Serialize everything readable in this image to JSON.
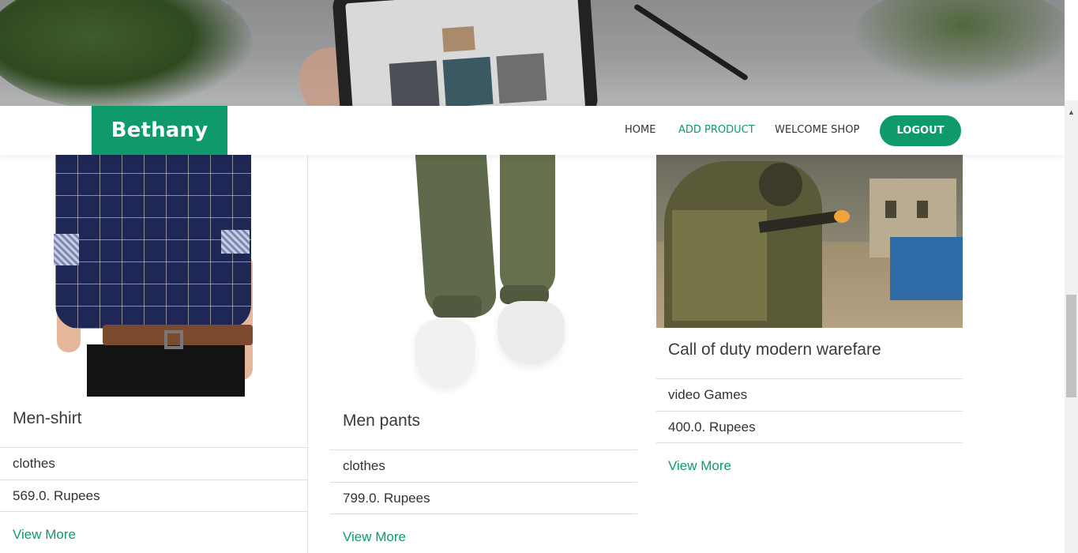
{
  "nav": {
    "brand": "Bethany",
    "links": [
      {
        "label": "HOME"
      },
      {
        "label": "ADD PRODUCT"
      },
      {
        "label": "WELCOME SHOP"
      }
    ],
    "logout_label": "LOGOUT"
  },
  "colors": {
    "accent": "#0f9a6b",
    "text": "#333333",
    "divider": "#dedede"
  },
  "icons": {
    "scroll_up": "chevron-up-icon"
  },
  "products": [
    {
      "title": "Men-shirt",
      "category": "clothes",
      "price": "569.0. Rupees",
      "link": "View More"
    },
    {
      "title": "Men pants",
      "category": "clothes",
      "price": "799.0. Rupees",
      "link": "View More"
    },
    {
      "title": "Call of duty modern warefare",
      "category": "video Games",
      "price": "400.0. Rupees",
      "link": "View More"
    }
  ]
}
